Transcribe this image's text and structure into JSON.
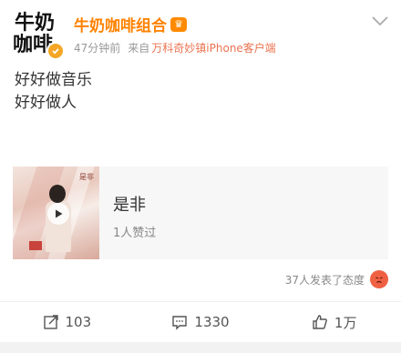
{
  "post": {
    "avatar_text_line1": "牛奶",
    "avatar_text_line2": "咖啡",
    "username": "牛奶咖啡组合",
    "time": "47分钟前",
    "source_prefix": "来自",
    "device": "万科奇妙镇iPhone客户端",
    "content_lines": [
      "好好做音乐",
      "好好做人"
    ]
  },
  "music_card": {
    "title": "是非",
    "likes": "1人赞过",
    "cover_mark": "是非"
  },
  "reactions": {
    "text": "37人发表了态度"
  },
  "actions": {
    "share_count": "103",
    "comment_count": "1330",
    "like_count": "1万"
  },
  "colors": {
    "username": "#ff8200",
    "device_link": "#eb7350",
    "reaction_icon": "#f06043"
  }
}
